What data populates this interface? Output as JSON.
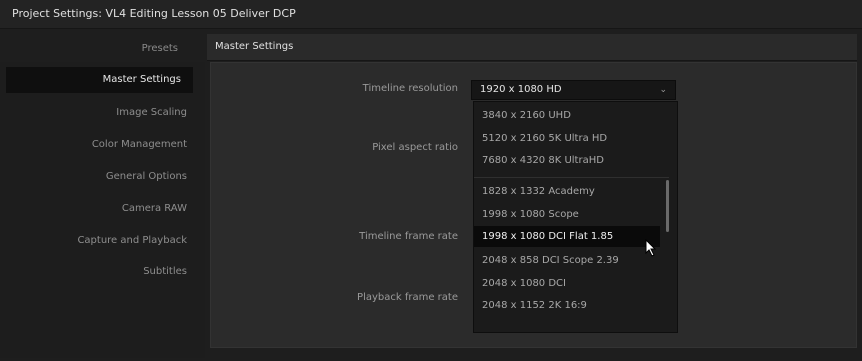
{
  "window": {
    "title": "Project Settings: VL4 Editing Lesson 05 Deliver DCP"
  },
  "presets_label": "Presets",
  "tab": {
    "label": "Master Settings"
  },
  "sidebar": {
    "items": [
      {
        "label": "Master Settings"
      },
      {
        "label": "Image Scaling"
      },
      {
        "label": "Color Management"
      },
      {
        "label": "General Options"
      },
      {
        "label": "Camera RAW"
      },
      {
        "label": "Capture and Playback"
      },
      {
        "label": "Subtitles"
      }
    ]
  },
  "fields": {
    "timeline_resolution_label": "Timeline resolution",
    "pixel_aspect_label": "Pixel aspect ratio",
    "timeline_frame_rate_label": "Timeline frame rate",
    "playback_frame_rate_label": "Playback frame rate"
  },
  "resolution_select": {
    "value": "1920 x 1080 HD",
    "icon": "chevron-down-icon"
  },
  "dropdown": {
    "options": [
      {
        "label": "3840 x 2160 UHD"
      },
      {
        "label": "5120 x 2160 5K Ultra HD"
      },
      {
        "label": "7680 x 4320 8K UltraHD"
      },
      {
        "label": "1828 x 1332 Academy"
      },
      {
        "label": "1998 x 1080 Scope"
      },
      {
        "label": "1998 x 1080 DCI Flat 1.85"
      },
      {
        "label": "2048 x 858 DCI Scope 2.39"
      },
      {
        "label": "2048 x 1080 DCI"
      },
      {
        "label": "2048 x 1152 2K 16:9"
      }
    ],
    "highlighted_index": 5
  },
  "colors": {
    "background": "#1c1c1c",
    "panel": "#2b2b2b",
    "highlight": "#0a0a0a"
  }
}
